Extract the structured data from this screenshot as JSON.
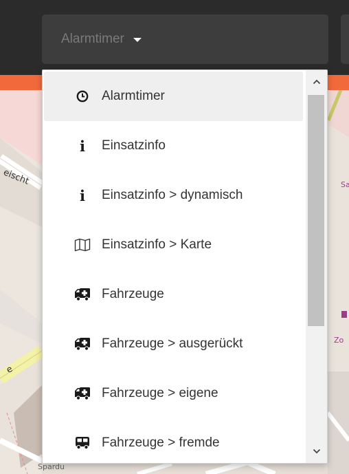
{
  "header": {
    "selector_label": "Alarmtimer",
    "caret_icon": "caret-down-icon"
  },
  "colors": {
    "topbar": "#2b2b2b",
    "selector_bg": "#3d3d3d",
    "accent_strip": "#f26a3c",
    "menu_selected_bg": "#efefef"
  },
  "map": {
    "labels": [
      "eischt",
      "Sa",
      "Zo",
      "Spardu",
      "e"
    ]
  },
  "menu": {
    "items": [
      {
        "label": "Alarmtimer",
        "icon": "clock-icon",
        "selected": true
      },
      {
        "label": "Einsatzinfo",
        "icon": "info-icon"
      },
      {
        "label": "Einsatzinfo > dynamisch",
        "icon": "info-icon"
      },
      {
        "label": "Einsatzinfo > Karte",
        "icon": "map-icon"
      },
      {
        "label": "Fahrzeuge",
        "icon": "ambulance-icon"
      },
      {
        "label": "Fahrzeuge > ausgerückt",
        "icon": "ambulance-icon"
      },
      {
        "label": "Fahrzeuge > eigene",
        "icon": "ambulance-icon"
      },
      {
        "label": "Fahrzeuge > fremde",
        "icon": "bus-icon"
      }
    ]
  },
  "scrollbar": {
    "up_icon": "chevron-up-icon",
    "down_icon": "chevron-down-icon"
  }
}
